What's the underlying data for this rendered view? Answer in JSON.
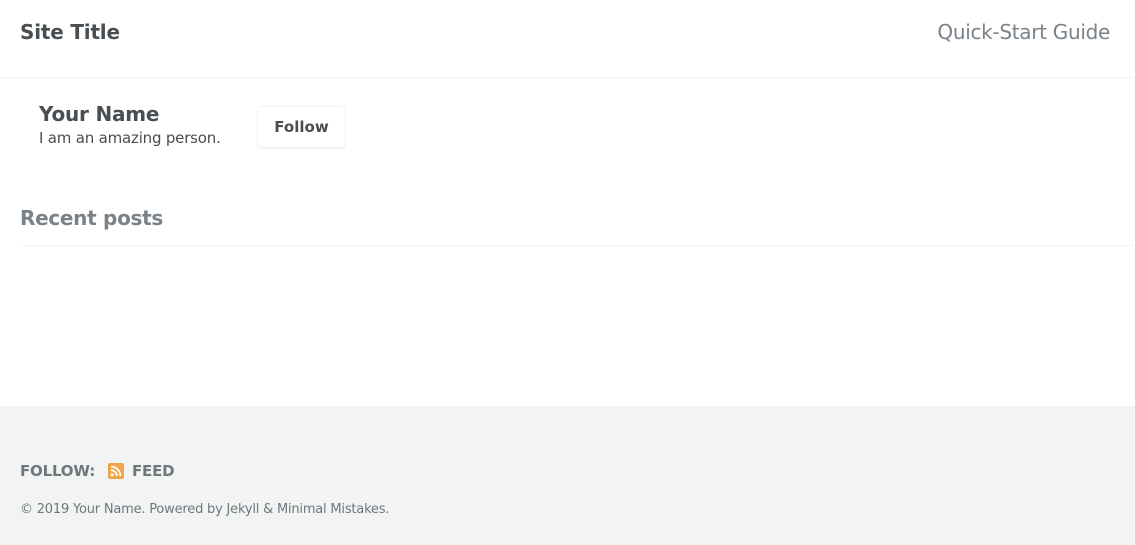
{
  "masthead": {
    "site_title": "Site Title",
    "nav_link": "Quick-Start Guide"
  },
  "author": {
    "name": "Your Name",
    "bio": "I am an amazing person.",
    "follow_label": "Follow"
  },
  "main": {
    "section_title": "Recent posts"
  },
  "footer": {
    "follow_label": "FOLLOW:",
    "feed_label": "FEED",
    "feed_icon": "rss-icon",
    "copyright": "© 2019 Your Name. Powered by Jekyll & Minimal Mistakes."
  },
  "colors": {
    "rss_accent": "#f2a448",
    "footer_bg": "#f2f3f3",
    "text": "#494e52",
    "muted": "#7a8288"
  }
}
